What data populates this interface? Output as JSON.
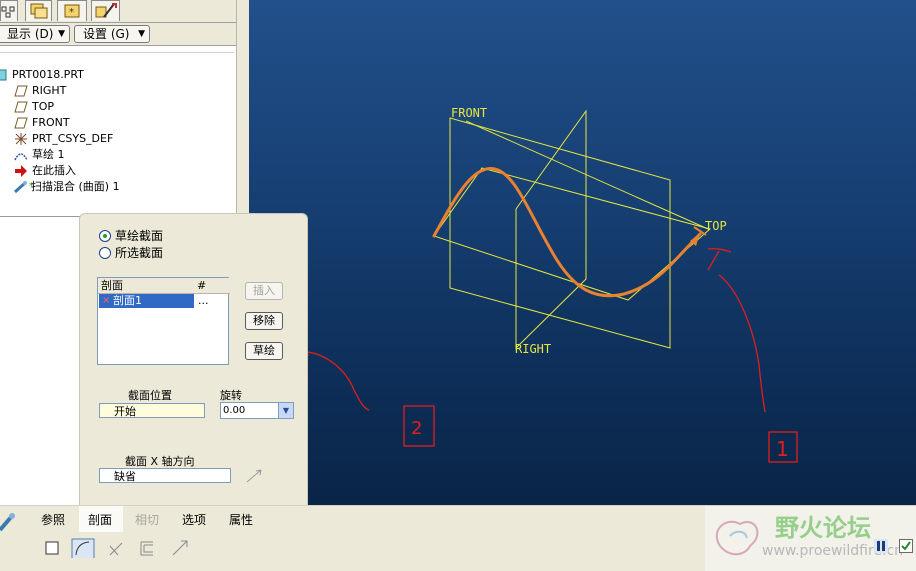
{
  "model_tree": {
    "display_menu_label": "显示 (D)",
    "settings_menu_label": "设置 (G)",
    "items": [
      {
        "label": "PRT0018.PRT"
      },
      {
        "label": "RIGHT"
      },
      {
        "label": "TOP"
      },
      {
        "label": "FRONT"
      },
      {
        "label": "PRT_CSYS_DEF"
      },
      {
        "label": "草绘 1"
      },
      {
        "label": "在此插入"
      },
      {
        "label": "扫描混合 (曲面) 1"
      }
    ]
  },
  "viewport": {
    "background_color": "#163f73",
    "datum_color": "#e6e63c",
    "curve_color": "#e8822e",
    "annotation_color": "#e01e1e",
    "plane_labels": {
      "front": "FRONT",
      "top": "TOP",
      "right": "RIGHT"
    },
    "annotations": {
      "label_1": "1",
      "label_2": "2"
    }
  },
  "section_panel": {
    "radio_sketched": "草绘截面",
    "radio_selected": "所选截面",
    "table": {
      "headers": [
        "剖面",
        "#"
      ],
      "rows": [
        {
          "name": "剖面1",
          "value": "..."
        }
      ]
    },
    "buttons": {
      "insert": "插入",
      "remove": "移除",
      "sketch": "草绘"
    },
    "position_label": "截面位置",
    "position_value": "开始",
    "rotation_label": "旋转",
    "rotation_value": "0.00",
    "xaxis_label": "截面 X 轴方向",
    "xaxis_value": "缺省"
  },
  "bottom_tabs": {
    "references": "参照",
    "sections": "剖面",
    "tangency": "相切",
    "options": "选项",
    "properties": "属性"
  },
  "watermark": {
    "title": "野火论坛",
    "url": "www.proewildfire.cn"
  }
}
